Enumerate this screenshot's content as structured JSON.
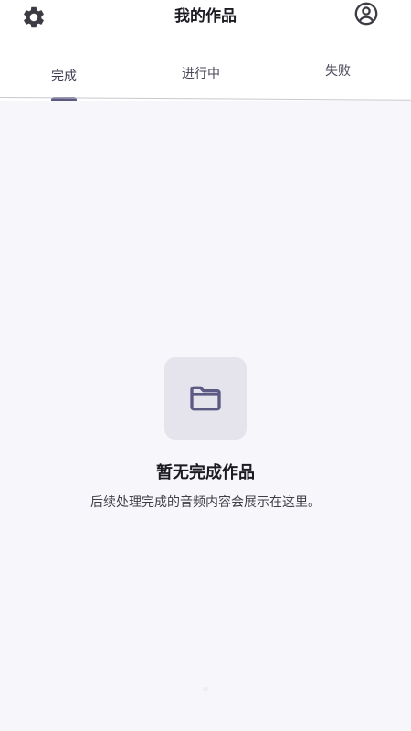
{
  "header": {
    "title": "我的作品",
    "settings_icon": "gear-icon",
    "profile_icon": "account-circle-icon"
  },
  "tabs": [
    {
      "label": "完成",
      "active": true
    },
    {
      "label": "进行中",
      "active": false
    },
    {
      "label": "失败",
      "active": false
    }
  ],
  "empty_state": {
    "icon": "folder-icon",
    "title": "暂无完成作品",
    "subtitle": "后续处理完成的音频内容会展示在这里。"
  },
  "colors": {
    "accent": "#5c5a83",
    "background": "#f7f6fb",
    "icon_box": "#e5e4ec",
    "text_primary": "#1c1b21"
  }
}
